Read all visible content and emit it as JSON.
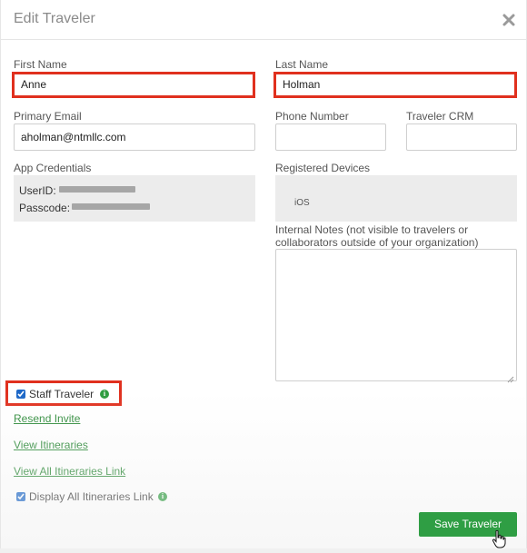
{
  "modal": {
    "title": "Edit Traveler",
    "close_icon": "close-icon"
  },
  "fields": {
    "first_name_label": "First Name",
    "first_name_value": "Anne",
    "last_name_label": "Last Name",
    "last_name_value": "Holman",
    "email_label": "Primary Email",
    "email_value": "aholman@ntmllc.com",
    "phone_label": "Phone Number",
    "phone_value": "",
    "crm_label": "Traveler CRM",
    "crm_value": ""
  },
  "credentials": {
    "label": "App Credentials",
    "userid_label": "UserID:",
    "passcode_label": "Passcode:"
  },
  "devices": {
    "label": "Registered Devices",
    "items": [
      "iOS"
    ]
  },
  "notes": {
    "label_line1": "Internal Notes (not visible to travelers or",
    "label_line2": "collaborators outside of your organization)",
    "value": ""
  },
  "staff_traveler": {
    "label": "Staff Traveler",
    "checked": true
  },
  "links": {
    "resend_invite": "Resend Invite",
    "view_itineraries": "View Itineraries",
    "view_all_itineraries_link": "View All Itineraries Link"
  },
  "display_all": {
    "label": "Display All Itineraries Link",
    "checked": true
  },
  "actions": {
    "save_label": "Save Traveler"
  },
  "colors": {
    "highlight": "#e0301e",
    "accent_green": "#2f9e44",
    "checkbox_blue": "#1c67c7"
  }
}
